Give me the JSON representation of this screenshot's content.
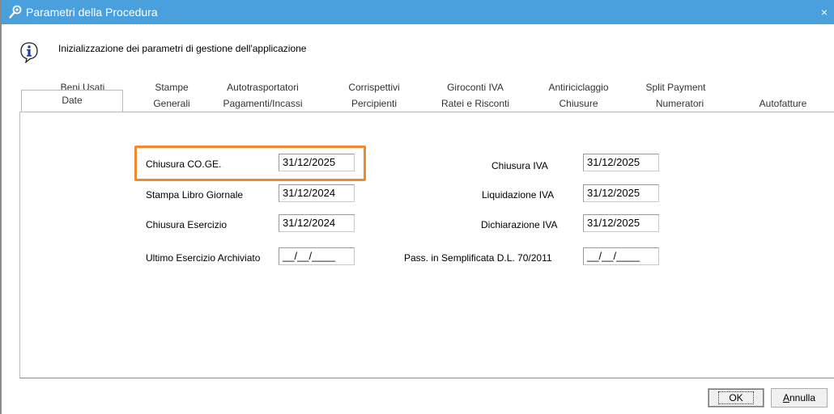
{
  "window": {
    "title": "Parametri della Procedura",
    "close_label": "×"
  },
  "info": {
    "text": "Inizializzazione dei parametri di gestione dell'applicazione",
    "icon": "info-icon"
  },
  "tabs": {
    "row1": [
      "Beni Usati",
      "Stampe",
      "Autotrasportatori",
      "Corrispettivi",
      "Giroconti IVA",
      "Antiriciclaggio",
      "Split Payment"
    ],
    "row2": [
      "Date",
      "Generali",
      "Pagamenti/Incassi",
      "Percipienti",
      "Ratei e Risconti",
      "Chiusure",
      "Numeratori",
      "Autofatture"
    ],
    "active": "Date"
  },
  "fields_left": [
    {
      "label": "Chiusura CO.GE.",
      "value": "31/12/2025"
    },
    {
      "label": "Stampa Libro Giornale",
      "value": "31/12/2024"
    },
    {
      "label": "Chiusura Esercizio",
      "value": "31/12/2024"
    },
    {
      "label": "Ultimo Esercizio Archiviato",
      "value": "__/__/____"
    }
  ],
  "fields_right": [
    {
      "label": "Chiusura IVA",
      "value": "31/12/2025"
    },
    {
      "label": "Liquidazione IVA",
      "value": "31/12/2025"
    },
    {
      "label": "Dichiarazione IVA",
      "value": "31/12/2025"
    },
    {
      "label": "Pass. in Semplificata D.L. 70/2011",
      "value": "__/__/____"
    }
  ],
  "buttons": {
    "ok": "OK",
    "cancel": "Annulla"
  },
  "colors": {
    "titlebar": "#4aa0dc",
    "highlight": "#f08a2e"
  }
}
